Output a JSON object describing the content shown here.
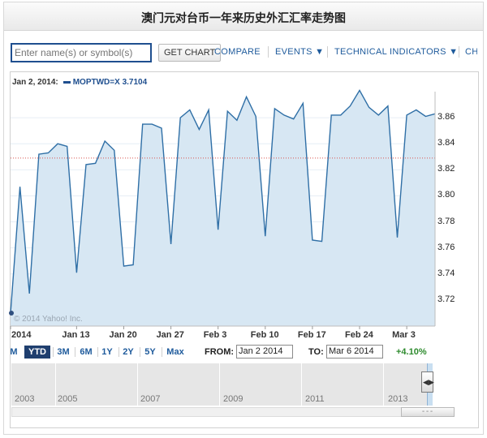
{
  "title": "澳门元对台币一年来历史外汇汇率走势图",
  "toolbar": {
    "input_placeholder": "Enter name(s) or symbol(s)",
    "get_chart_label": "GET CHART",
    "compare_label": "COMPARE",
    "events_label": "EVENTS ▼",
    "indicators_label": "TECHNICAL INDICATORS ▼",
    "cut_label": "CH"
  },
  "readout": {
    "date": "Jan 2, 2014:",
    "symbol": "MOPTWD=X",
    "value": "3.7104"
  },
  "credit": "© 2014 Yahoo! Inc.",
  "range": {
    "buttons": [
      "M",
      "YTD",
      "3M",
      "6M",
      "1Y",
      "2Y",
      "5Y",
      "Max"
    ],
    "selected": "YTD",
    "from_label": "FROM:",
    "from_value": "Jan 2 2014",
    "to_label": "TO:",
    "to_value": "Mar 6 2014",
    "change": "+4.10%"
  },
  "navigator": {
    "years": [
      "2003",
      "2005",
      "2007",
      "2009",
      "2011",
      "2013"
    ]
  },
  "chart_data": {
    "type": "area",
    "title": "",
    "xlabel": "",
    "ylabel": "",
    "ylim": [
      3.7,
      3.88
    ],
    "yticks": [
      "3.72",
      "3.74",
      "3.76",
      "3.78",
      "3.80",
      "3.82",
      "3.84",
      "3.86"
    ],
    "xticks": [
      "2014",
      "Jan 13",
      "Jan 20",
      "Jan 27",
      "Feb 3",
      "Feb 10",
      "Feb 17",
      "Feb 24",
      "Mar 3"
    ],
    "reference_line": 3.829,
    "grid": true,
    "series": [
      {
        "values": [
          3.71,
          3.807,
          3.725,
          3.832,
          3.833,
          3.84,
          3.838,
          3.741,
          3.824,
          3.825,
          3.842,
          3.835,
          3.746,
          3.747,
          3.855,
          3.855,
          3.852,
          3.763,
          3.86,
          3.866,
          3.851,
          3.866,
          3.774,
          3.865,
          3.858,
          3.876,
          3.861,
          3.769,
          3.867,
          3.862,
          3.859,
          3.871,
          3.766,
          3.765,
          3.862,
          3.862,
          3.869,
          3.881,
          3.868,
          3.862,
          3.869,
          3.768,
          3.862,
          3.866,
          3.861,
          3.863
        ]
      }
    ],
    "colors": {
      "line": "#2f6fa6",
      "fill": "#d7e7f3",
      "reference": "#d9534f",
      "grid": "#e6eef5"
    }
  }
}
